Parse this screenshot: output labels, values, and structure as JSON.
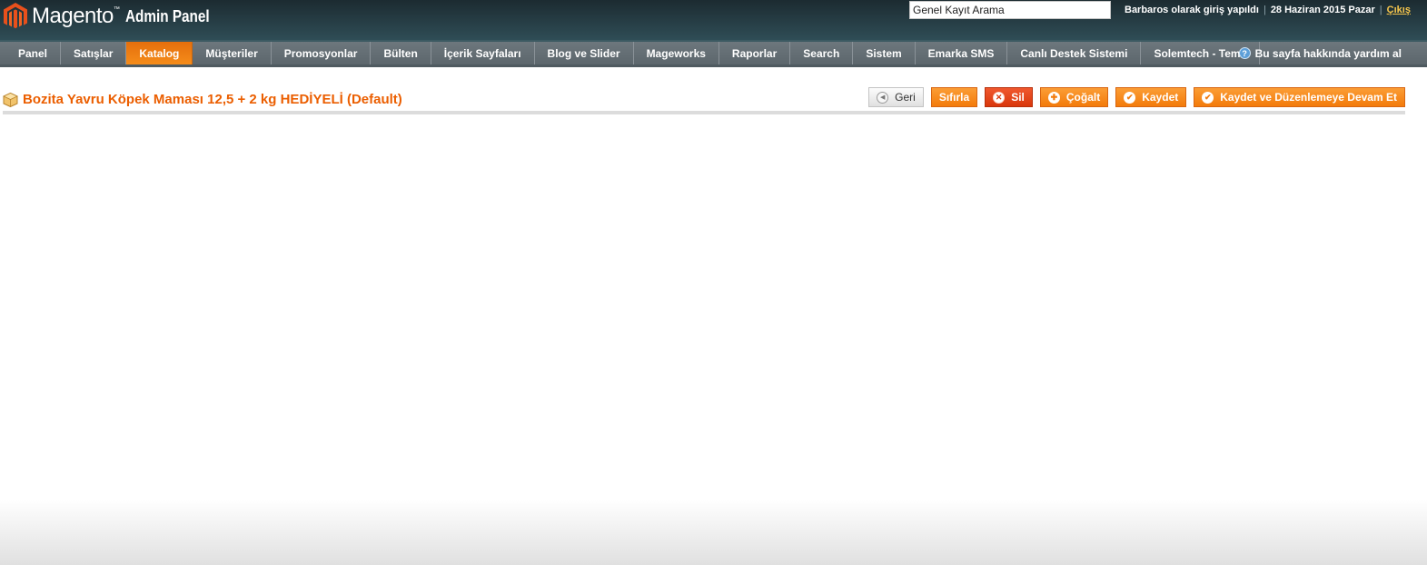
{
  "header": {
    "brand": "Magento",
    "trademark": "™",
    "subtitle": "Admin Panel",
    "search_value": "Genel Kayıt Arama",
    "logged_in_text": "Barbaros olarak giriş yapıldı",
    "date": "28 Haziran 2015 Pazar",
    "separator": "|",
    "logout": "Çıkış"
  },
  "nav": {
    "items": [
      {
        "label": "Panel"
      },
      {
        "label": "Satışlar"
      },
      {
        "label": "Katalog",
        "active": true
      },
      {
        "label": "Müşteriler"
      },
      {
        "label": "Promosyonlar"
      },
      {
        "label": "Bülten"
      },
      {
        "label": "İçerik Sayfaları"
      },
      {
        "label": "Blog ve Slider"
      },
      {
        "label": "Mageworks"
      },
      {
        "label": "Raporlar"
      },
      {
        "label": "Search"
      },
      {
        "label": "Sistem"
      },
      {
        "label": "Emarka SMS"
      },
      {
        "label": "Canlı Destek Sistemi"
      },
      {
        "label": "Solemtech - Tema"
      }
    ],
    "help_label": "Bu sayfa hakkında yardım al",
    "help_icon": "?"
  },
  "page": {
    "title": "Bozita Yavru Köpek Maması 12,5 + 2 kg HEDİYELİ (Default)",
    "buttons": {
      "back": "Geri",
      "reset": "Sıfırla",
      "delete": "Sil",
      "duplicate": "Çoğalt",
      "save": "Kaydet",
      "save_continue": "Kaydet ve Düzenlemeye Devam Et"
    }
  },
  "colors": {
    "accent": "#eb5e00",
    "header_bg": "#2f4d56",
    "nav_bg": "#636d73",
    "button_orange": "#f37b0b",
    "button_red": "#d9370c"
  }
}
